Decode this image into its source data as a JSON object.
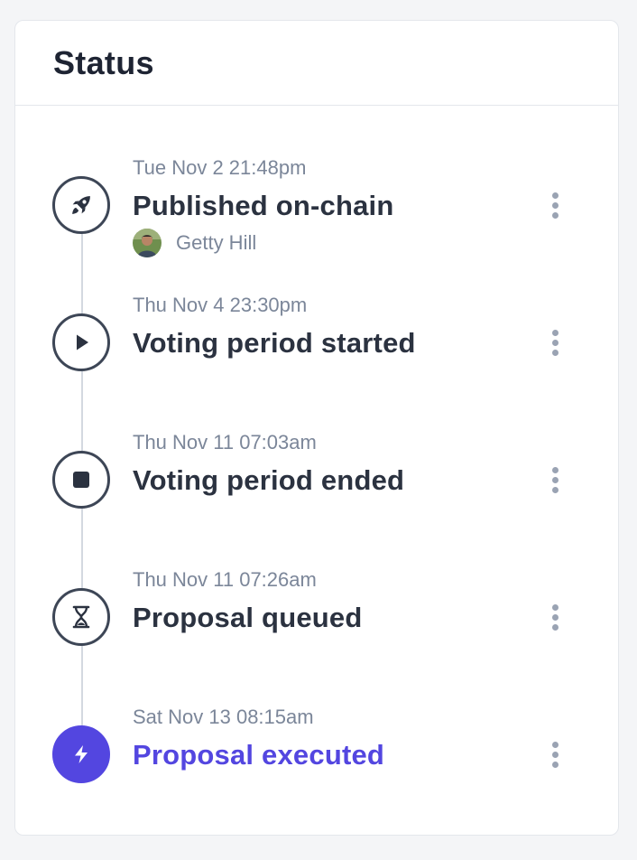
{
  "card": {
    "title": "Status"
  },
  "events": [
    {
      "time": "Tue Nov 2 21:48pm",
      "title": "Published on-chain",
      "icon": "rocket-icon",
      "author": "Getty Hill",
      "active": false
    },
    {
      "time": "Thu Nov 4 23:30pm",
      "title": "Voting period started",
      "icon": "play-icon",
      "active": false
    },
    {
      "time": "Thu Nov 11 07:03am",
      "title": "Voting period ended",
      "icon": "stop-icon",
      "active": false
    },
    {
      "time": "Thu Nov 11 07:26am",
      "title": "Proposal queued",
      "icon": "hourglass-icon",
      "active": false
    },
    {
      "time": "Sat Nov 13 08:15am",
      "title": "Proposal executed",
      "icon": "lightning-icon",
      "active": true
    }
  ],
  "colors": {
    "accent": "#5346e0",
    "text_primary": "#2b3240",
    "text_muted": "#7b8699",
    "icon_border": "#3d4656",
    "timeline": "#d3d8e0",
    "kebab": "#9aa3b3"
  }
}
